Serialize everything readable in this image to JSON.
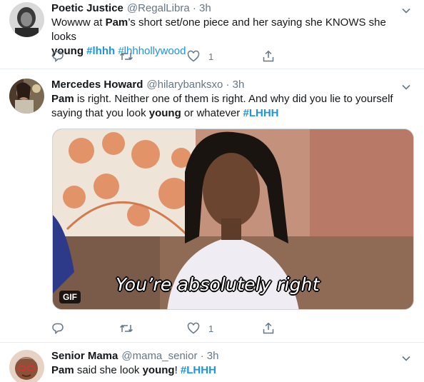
{
  "tweets": [
    {
      "name": "Poetic Justice",
      "handle": "@RegalLibra · 3h",
      "text": {
        "l1_a": "Wowww at ",
        "l1_b": "Pam",
        "l1_c": "’s short set/one piece and her saying she KNOWS she looks",
        "l2_a": "young",
        "l2_b": " ",
        "l2_c": "#lhhh",
        "l2_d": " ",
        "l2_e": "#lhhhollywood"
      },
      "likes": "1"
    },
    {
      "name": "Mercedes Howard",
      "handle": "@hilarybanksxo · 3h",
      "text": {
        "l1_a": "Pam",
        "l1_b": " is right. Neither one of them is right. And why did you lie to yourself",
        "l2_a": "saying that you look ",
        "l2_b": "young",
        "l2_c": " or whatever ",
        "l2_d": "#LHHH"
      },
      "media": {
        "caption": "You’re absolutely right",
        "badge": "GIF"
      },
      "likes": "1"
    },
    {
      "name": "Senior Mama",
      "handle": "@mama_senior · 3h",
      "text": {
        "a": "Pam",
        "b": " said she look ",
        "c": "young",
        "d": "!  ",
        "e": "#LHHH"
      }
    }
  ],
  "icons": {
    "reply": "reply-icon",
    "retweet": "retweet-icon",
    "like": "heart-icon",
    "share": "share-icon",
    "more": "chevron-down-icon"
  },
  "colors": {
    "link": "#1b95e0",
    "muted": "#657786",
    "divider": "#e6ecf0"
  }
}
